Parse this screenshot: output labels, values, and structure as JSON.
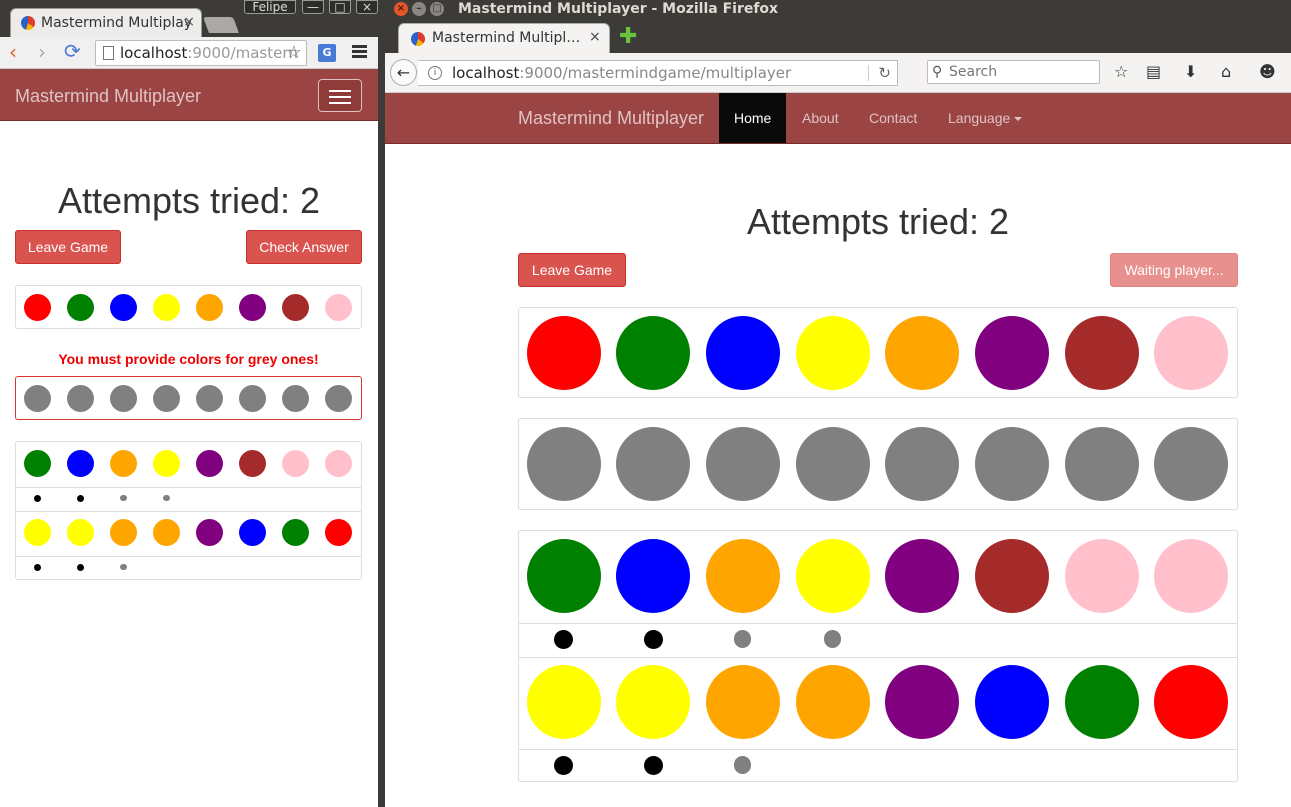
{
  "left_window": {
    "tab_title": "Mastermind Multiplayer",
    "tab_close": "×",
    "user_name": "Felipe",
    "window_buttons": [
      "—",
      "□",
      "×"
    ],
    "url_scheme_host": "localhost",
    "url_rest": ":9000/mastern",
    "translate_label": "G",
    "brand": "Mastermind Multiplayer",
    "attempts_title": "Attempts tried: 2",
    "leave_label": "Leave Game",
    "check_label": "Check Answer",
    "error_message": "You must provide colors for grey ones!"
  },
  "right_window": {
    "window_title": "Mastermind Multiplayer - Mozilla Firefox",
    "tab_title": "Mastermind Multipl…",
    "tab_close": "×",
    "url_host": "localhost",
    "url_rest": ":9000/mastermindgame/multiplayer",
    "search_placeholder": "Search",
    "brand": "Mastermind Multiplayer",
    "nav": {
      "home": "Home",
      "about": "About",
      "contact": "Contact",
      "language": "Language"
    },
    "attempts_title": "Attempts tried: 2",
    "leave_label": "Leave Game",
    "waiting_label": "Waiting player..."
  },
  "colors": {
    "brand_navbar": "#9a4443",
    "danger_button": "#d9534f",
    "peg_grey": "#808080"
  },
  "game": {
    "palette": [
      "red",
      "green",
      "blue",
      "yellow",
      "orange",
      "purple",
      "brown",
      "pink"
    ],
    "current_guess": [
      "grey",
      "grey",
      "grey",
      "grey",
      "grey",
      "grey",
      "grey",
      "grey"
    ],
    "attempts": [
      {
        "guess": [
          "green",
          "blue",
          "orange",
          "yellow",
          "purple",
          "brown",
          "pink",
          "pink"
        ],
        "feedback": [
          "black",
          "black",
          "grey",
          "grey"
        ]
      },
      {
        "guess": [
          "yellow",
          "yellow",
          "orange",
          "orange",
          "purple",
          "blue",
          "green",
          "red"
        ],
        "feedback": [
          "black",
          "black",
          "grey"
        ]
      }
    ]
  }
}
